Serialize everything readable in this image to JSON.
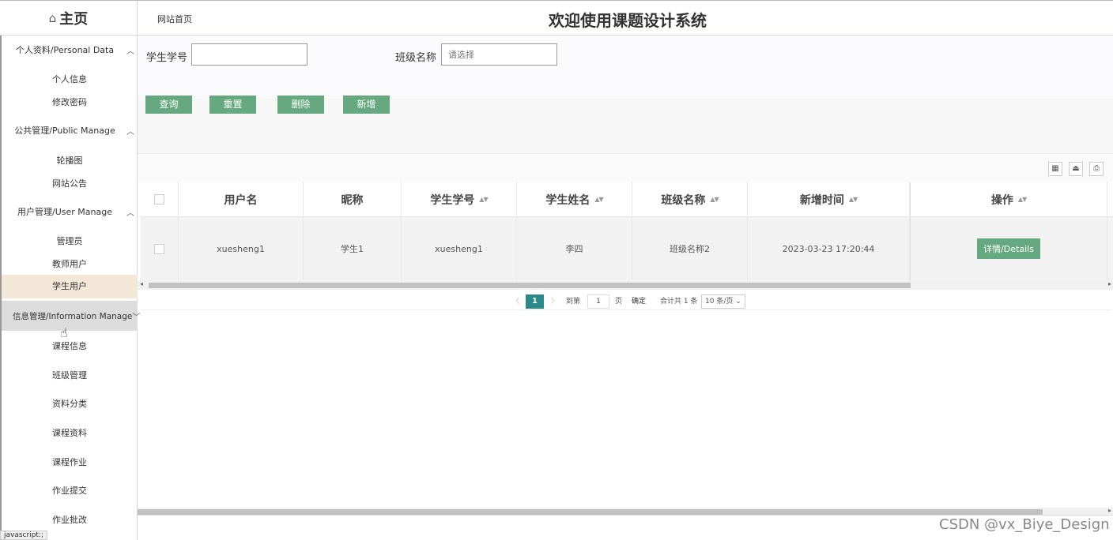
{
  "header": {
    "home_icon": "⌂",
    "home_label": "主页",
    "site_link": "网站首页",
    "title": "欢迎使用课题设计系统"
  },
  "sidebar": {
    "groups": [
      {
        "label": "个人资料/Personal Data",
        "chevron": "^",
        "items": [
          "个人信息",
          "修改密码"
        ]
      },
      {
        "label": "公共管理/Public Manage",
        "chevron": "^",
        "items": [
          "轮播图",
          "网站公告"
        ]
      },
      {
        "label": "用户管理/User Manage",
        "chevron": "^",
        "items": [
          "管理员",
          "教师用户",
          "学生用户"
        ]
      },
      {
        "label": "信息管理/Information Manage",
        "chevron": "v",
        "items": [
          "课程信息",
          "班级管理",
          "资料分类",
          "课程资料",
          "课程作业",
          "作业提交",
          "作业批改"
        ]
      }
    ],
    "active_item": "学生用户",
    "active_group": "信息管理/Information Manage"
  },
  "search": {
    "student_no_label": "学生学号",
    "student_no_value": "",
    "class_label": "班级名称",
    "class_placeholder": "请选择"
  },
  "buttons": {
    "query": "查询",
    "reset": "重置",
    "delete": "删除",
    "add": "新增"
  },
  "tools": {
    "grid": "▦",
    "export": "⏏",
    "print": "⎙"
  },
  "table": {
    "headers": [
      "用户名",
      "昵称",
      "学生学号",
      "学生姓名",
      "班级名称",
      "新增时间",
      "操作"
    ],
    "sort_icon": "▲▼",
    "rows": [
      {
        "username": "xuesheng1",
        "nickname": "学生1",
        "student_no": "xuesheng1",
        "student_name": "李四",
        "class_name": "班级名称2",
        "created": "2023-03-23 17:20:44",
        "action": "详情/Details"
      }
    ]
  },
  "pager": {
    "prev": "〈",
    "current": "1",
    "next": "〉",
    "goto_label": "到第",
    "goto_value": "1",
    "page_unit": "页",
    "confirm": "确定",
    "total": "合计共 1 条",
    "page_size": "10 条/页"
  },
  "statusbar": "javascript:;",
  "watermark": "CSDN @vx_Biye_Design"
}
